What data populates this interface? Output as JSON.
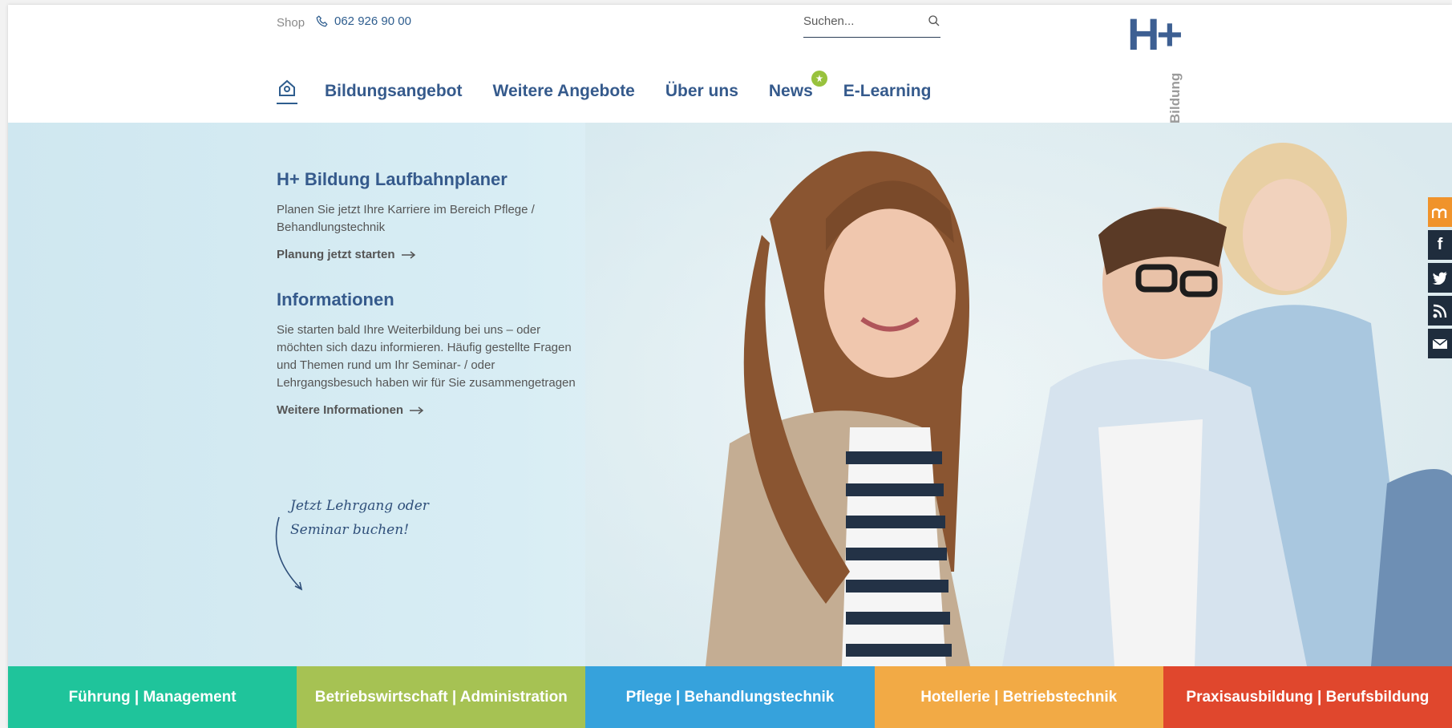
{
  "header": {
    "shop": "Shop",
    "phone": "062 926 90 00",
    "search_placeholder": "Suchen...",
    "logo": {
      "mark": "H+",
      "word": "Bildung"
    }
  },
  "nav": {
    "items": [
      {
        "label": "Bildungsangebot"
      },
      {
        "label": "Weitere Angebote"
      },
      {
        "label": "Über uns"
      },
      {
        "label": "News"
      },
      {
        "label": "E-Learning"
      }
    ]
  },
  "hero": {
    "block1": {
      "title": "H+ Bildung Laufbahnplaner",
      "line1": "Planen Sie jetzt Ihre Karriere im Bereich Pflege /",
      "line2": "Behandlungstechnik",
      "link": "Planung jetzt starten"
    },
    "block2": {
      "title": "Informationen",
      "line1": "Sie starten bald Ihre Weiterbildung bei uns – oder",
      "line2": "möchten sich dazu informieren. Häufig gestellte Fragen",
      "line3": "und Themen rund um Ihr Seminar- / oder",
      "line4": "Lehrgangsbesuch haben wir für Sie zusammengetragen",
      "link": "Weitere Informationen"
    },
    "handwriting": {
      "line1": "Jetzt Lehrgang oder",
      "line2": "Seminar buchen!"
    }
  },
  "categories": [
    {
      "label": "Führung | Management",
      "color": "#1fc49b"
    },
    {
      "label": "Betriebswirtschaft | Administration",
      "color": "#a6c253"
    },
    {
      "label": "Pflege | Behandlungstechnik",
      "color": "#36a2dc"
    },
    {
      "label": "Hotellerie | Betriebstechnik",
      "color": "#f2aa45"
    },
    {
      "label": "Praxisausbildung | Berufsbildung",
      "color": "#e0472d"
    }
  ],
  "social": {
    "icons": [
      "moodle-icon",
      "facebook-icon",
      "twitter-icon",
      "rss-icon",
      "mail-icon"
    ],
    "facebook_glyph": "f"
  },
  "colors": {
    "brand": "#355a8c",
    "accent": "#98c23d"
  }
}
